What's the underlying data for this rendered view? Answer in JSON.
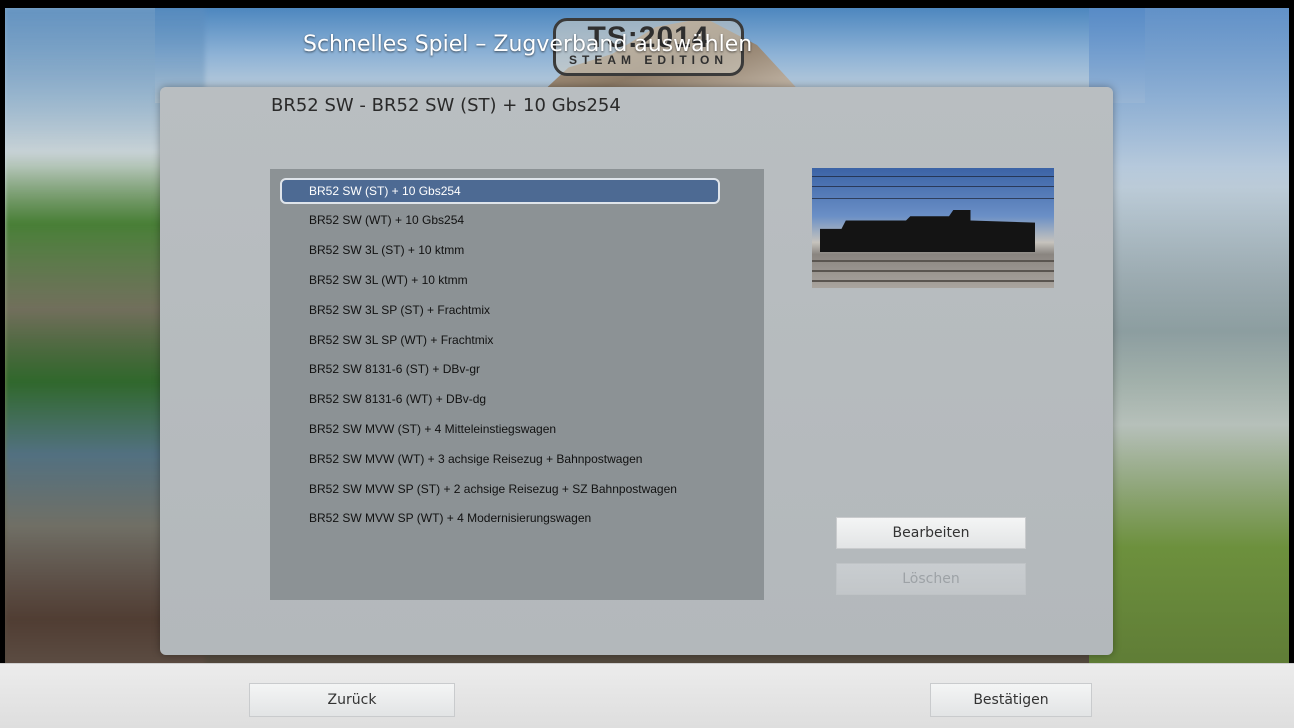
{
  "header": {
    "screen_title": "Schnelles Spiel – Zugverband auswählen",
    "logo_line1": "TS:2014",
    "logo_line2": "STEAM EDITION"
  },
  "panel": {
    "title": "BR52 SW - BR52 SW (ST) + 10 Gbs254"
  },
  "consists": {
    "selected_index": 0,
    "items": [
      "BR52 SW (ST) + 10 Gbs254",
      "BR52 SW (WT) + 10 Gbs254",
      "BR52 SW 3L (ST) + 10 ktmm",
      "BR52 SW 3L (WT) + 10 ktmm",
      "BR52 SW 3L SP (ST) + Frachtmix",
      "BR52 SW 3L SP (WT) + Frachtmix",
      "BR52 SW 8131-6 (ST) + DBv-gr",
      "BR52 SW 8131-6 (WT) + DBv-dg",
      "BR52 SW MVW (ST) + 4 Mitteleinstiegswagen",
      "BR52 SW MVW (WT) + 3 achsige Reisezug + Bahnpostwagen",
      "BR52 SW MVW SP (ST) + 2 achsige Reisezug + SZ Bahnpostwagen",
      "BR52 SW MVW SP (WT) + 4 Modernisierungswagen"
    ]
  },
  "buttons": {
    "edit": "Bearbeiten",
    "delete": "Löschen",
    "back": "Zurück",
    "confirm": "Bestätigen"
  },
  "colors": {
    "selection": "#4d6a93",
    "list_bg": "#8c9295",
    "panel_bg": "#b7bcbf"
  }
}
